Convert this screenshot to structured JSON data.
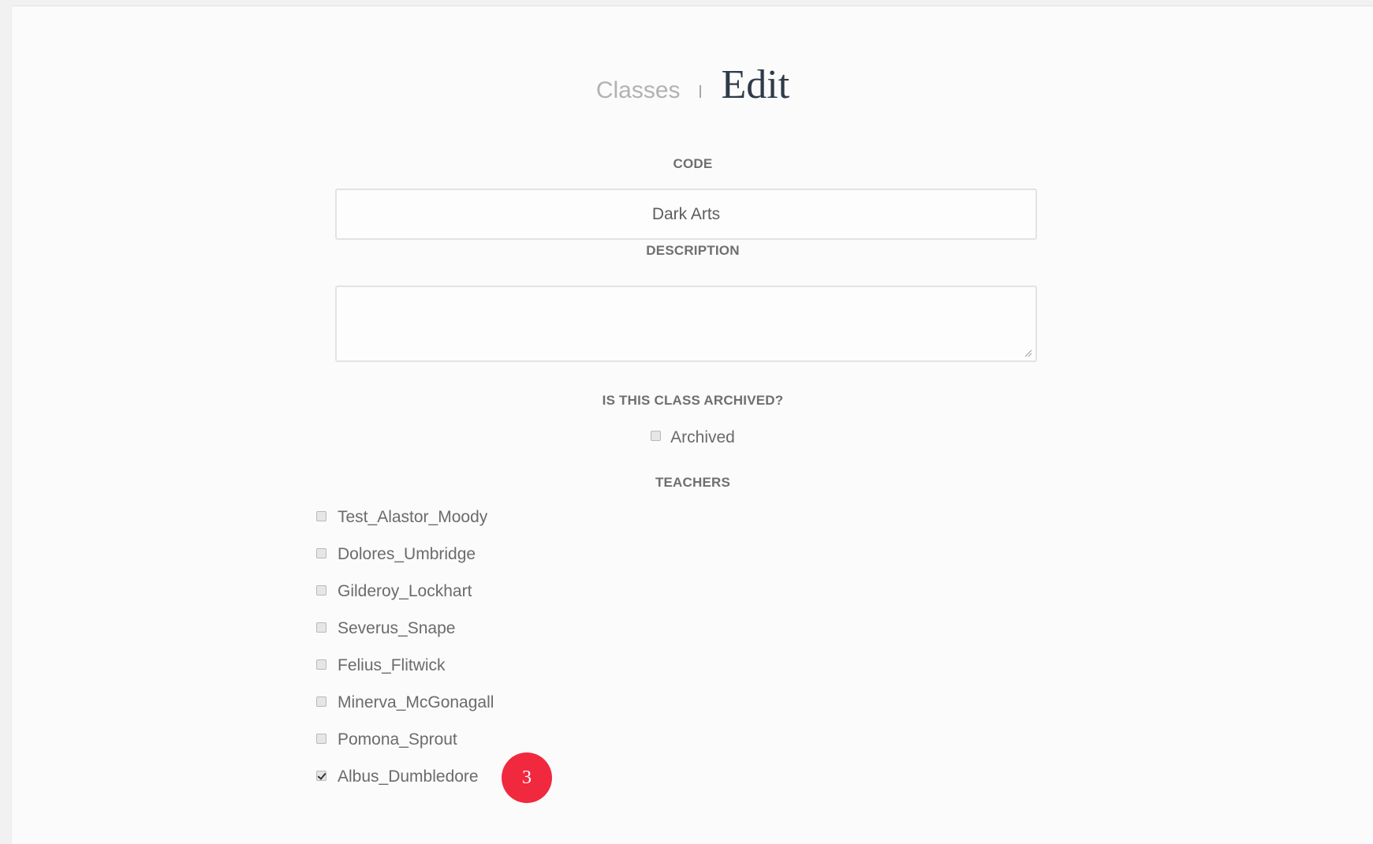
{
  "header": {
    "breadcrumb_parent": "Classes",
    "page_title": "Edit"
  },
  "form": {
    "code": {
      "label": "CODE",
      "value": "Dark Arts"
    },
    "description": {
      "label": "DESCRIPTION",
      "value": ""
    },
    "archived": {
      "label": "IS THIS CLASS ARCHIVED?",
      "checkbox_label": "Archived",
      "checked": false
    },
    "teachers": {
      "label": "TEACHERS",
      "items": [
        {
          "name": "Test_Alastor_Moody",
          "checked": false
        },
        {
          "name": "Dolores_Umbridge",
          "checked": false
        },
        {
          "name": "Gilderoy_Lockhart",
          "checked": false
        },
        {
          "name": "Severus_Snape",
          "checked": false
        },
        {
          "name": "Felius_Flitwick",
          "checked": false
        },
        {
          "name": "Minerva_McGonagall",
          "checked": false
        },
        {
          "name": "Pomona_Sprout",
          "checked": false
        },
        {
          "name": "Albus_Dumbledore",
          "checked": true
        }
      ]
    }
  },
  "annotation": {
    "step_number": "3",
    "color": "#f0293f"
  },
  "colors": {
    "page_background": "#fbfbfb",
    "title": "#2f3a4a",
    "breadcrumb": "#b2b2b2"
  }
}
